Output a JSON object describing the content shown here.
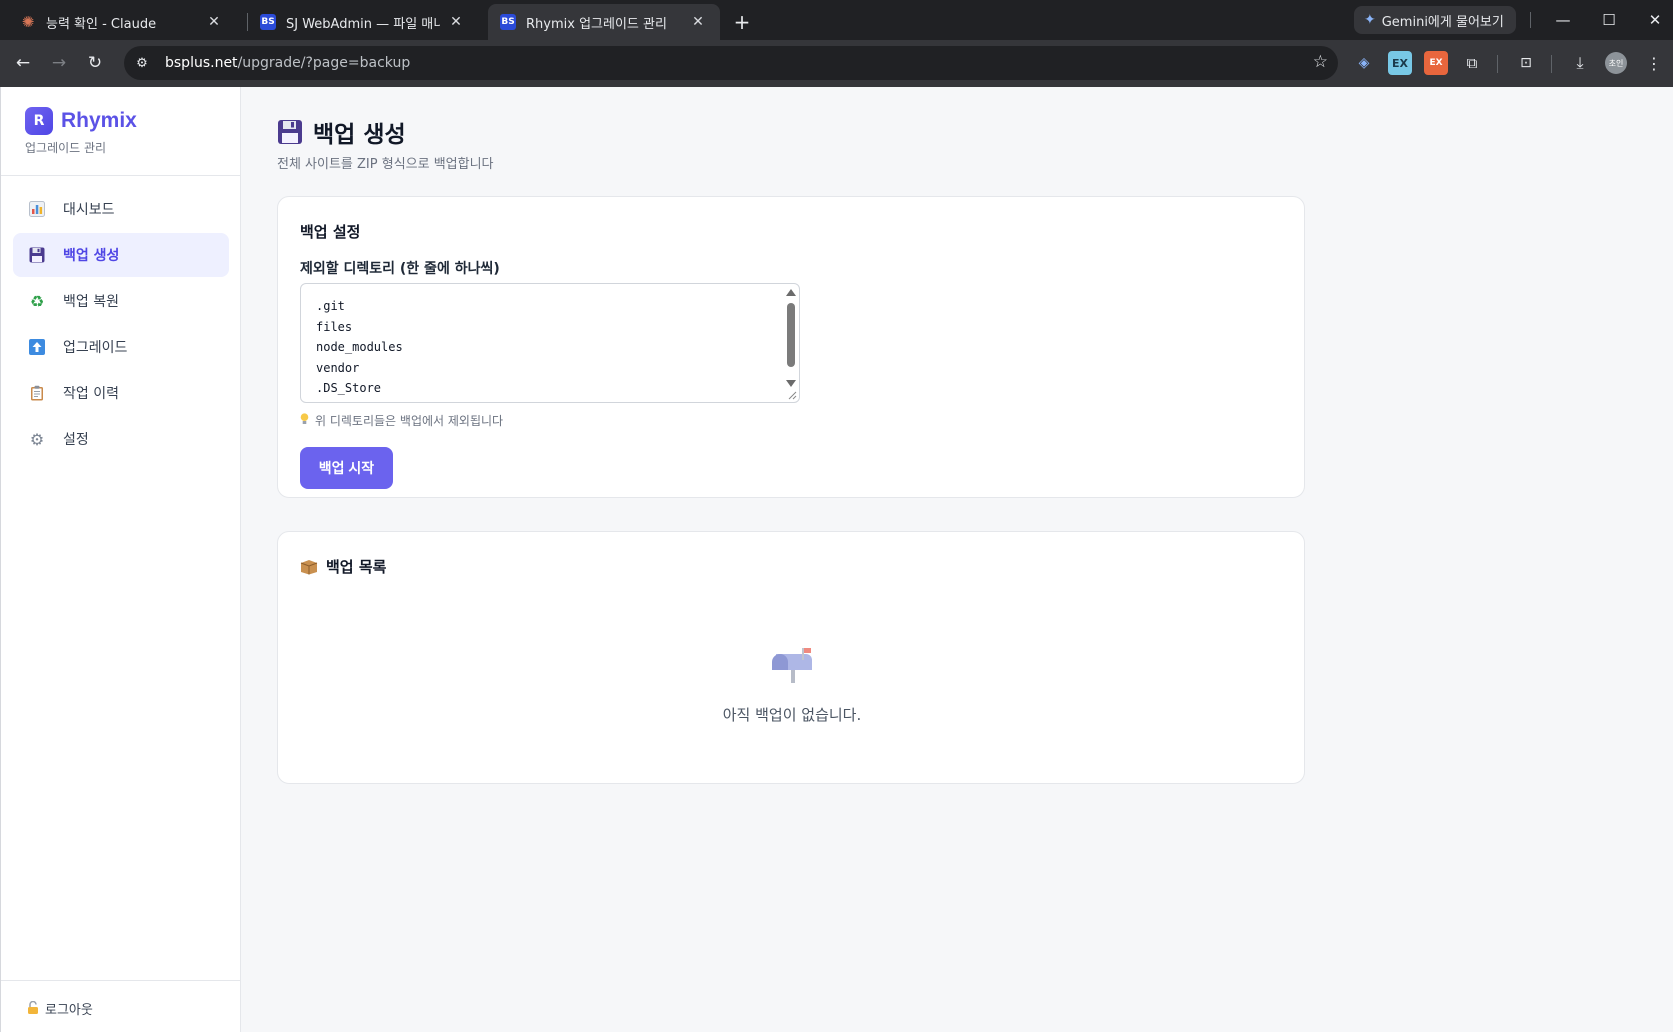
{
  "browser": {
    "tabs": [
      {
        "title": "능력 확인 - Claude",
        "favicon": "claude-icon",
        "active": false
      },
      {
        "title": "SJ WebAdmin — 파일 매니저",
        "favicon": "bs-icon",
        "active": false
      },
      {
        "title": "Rhymix 업그레이드 관리",
        "favicon": "bs-icon",
        "active": true
      }
    ],
    "gemini_label": "Gemini에게 물어보기",
    "url_host": "bsplus.net",
    "url_path": "/upgrade/?page=backup",
    "profile_initials": "초인",
    "ext_labels": {
      "ex1": "EX",
      "ex2": "EX"
    }
  },
  "sidebar": {
    "brand_name": "Rhymix",
    "brand_logo_letter": "R",
    "brand_subtitle": "업그레이드 관리",
    "items": [
      {
        "label": "대시보드",
        "icon": "chart-icon",
        "active": false
      },
      {
        "label": "백업 생성",
        "icon": "floppy-disk-icon",
        "active": true
      },
      {
        "label": "백업 복원",
        "icon": "recycle-icon",
        "active": false
      },
      {
        "label": "업그레이드",
        "icon": "up-arrow-icon",
        "active": false
      },
      {
        "label": "작업 이력",
        "icon": "clipboard-icon",
        "active": false
      },
      {
        "label": "설정",
        "icon": "gear-icon",
        "active": false
      }
    ],
    "logout_label": "로그아웃"
  },
  "main": {
    "title": "백업 생성",
    "description": "전체 사이트를 ZIP 형식으로 백업합니다",
    "settings_card": {
      "title": "백업 설정",
      "exclude_label": "제외할 디렉토리 (한 줄에 하나씩)",
      "exclude_lines": [
        ".git",
        "files",
        "node_modules",
        "vendor",
        ".DS_Store"
      ],
      "hint": "위 디렉토리들은 백업에서 제외됩니다",
      "start_button": "백업 시작"
    },
    "list_card": {
      "title": "백업 목록",
      "empty_message": "아직 백업이 없습니다."
    }
  },
  "colors": {
    "accent": "#6b63ee",
    "brand": "#5b52e6",
    "active_nav_bg": "#eef0ff"
  }
}
